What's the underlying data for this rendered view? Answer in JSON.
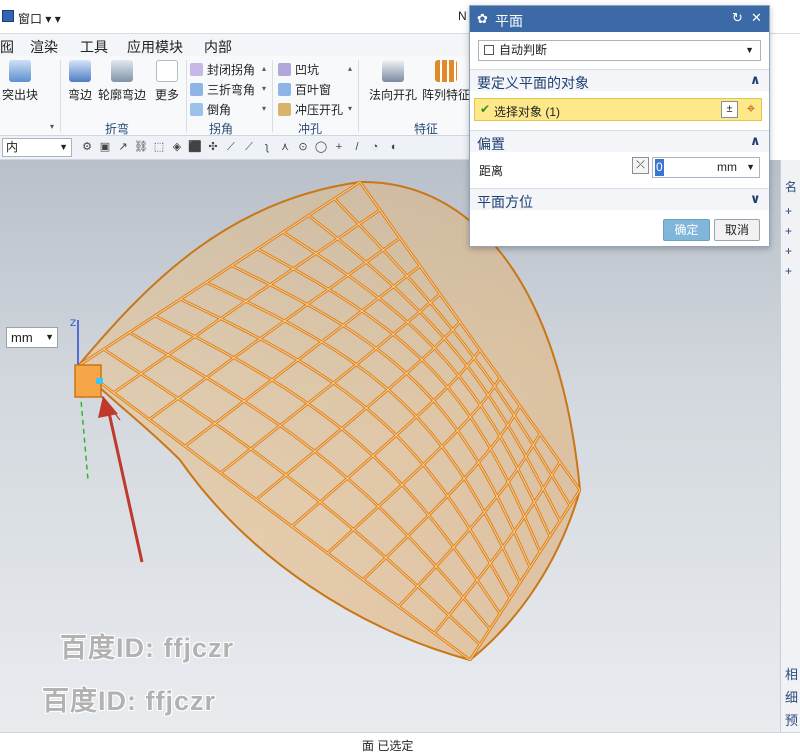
{
  "titlebar": {
    "window_menu": "窗口",
    "partial_title": "N"
  },
  "menubar": {
    "items": [
      "囮",
      "渲染",
      "工具",
      "应用模块",
      "内部"
    ]
  },
  "ribbon": {
    "buttons": {
      "emboss": "突出块",
      "flange": "弯边",
      "contour_flange": "轮廓弯边",
      "more": "更多",
      "normal_cutout": "法向开孔",
      "pattern": "阵列特征"
    },
    "small_items": {
      "closed_corner": "封闭拐角",
      "three_bend_corner": "三折弯角",
      "chamfer": "倒角",
      "dimple": "凹坑",
      "louver": "百叶窗",
      "drawn_cutout": "冲压开孔"
    },
    "groups": {
      "bend": "折弯",
      "corner": "拐角",
      "punch": "冲孔",
      "feature": "特征"
    }
  },
  "filterbar": {
    "select_value": "内"
  },
  "viewport": {
    "unit_value": "mm"
  },
  "watermark": {
    "line1": "百度ID: ffjczr",
    "line2": "百度ID: ffjczr"
  },
  "dialog": {
    "title": "平面",
    "type_value": "自动判断",
    "section_objects": "要定义平面的对象",
    "select_object": "选择对象 (1)",
    "section_offset": "偏置",
    "distance_label": "距离",
    "distance_value": "0",
    "distance_unit": "mm",
    "section_orientation": "平面方位",
    "ok": "确定",
    "cancel": "取消"
  },
  "rightpanel": {
    "items": [
      "名",
      "+",
      "+",
      "+",
      "+",
      "相",
      "细",
      "预"
    ]
  },
  "statusbar": {
    "text": "面 已选定"
  },
  "colors": {
    "mesh_orange": "#f2a33a",
    "title_blue": "#3b6aa6",
    "highlight_yellow": "#fde88a",
    "arrow_red": "#c0392b"
  }
}
